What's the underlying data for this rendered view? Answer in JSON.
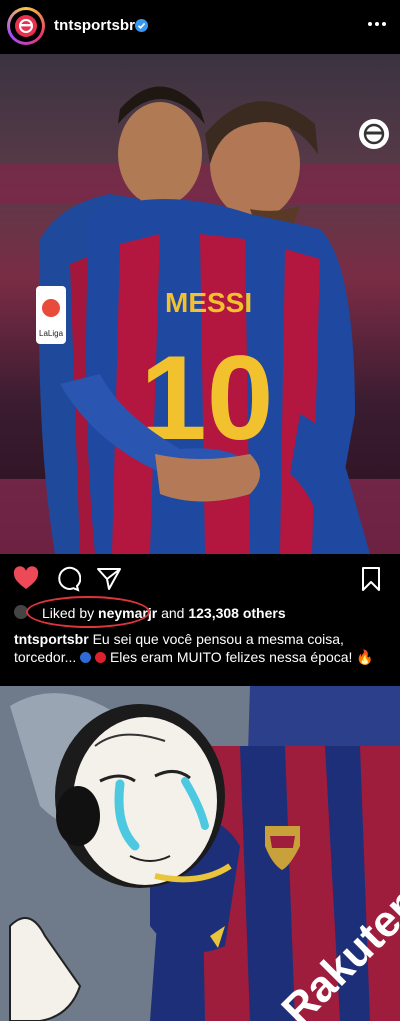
{
  "header": {
    "username": "tntsportsbr",
    "verified_icon": "verified-badge-icon",
    "more_icon": "more-options-icon"
  },
  "post_image_1": {
    "jersey_name": "MESSI",
    "jersey_number": "10",
    "sleeve_badge": "LaLiga"
  },
  "actions": {
    "like_icon": "heart-icon",
    "comment_icon": "comment-icon",
    "share_icon": "share-icon",
    "save_icon": "bookmark-icon",
    "like_color": "#ed4956"
  },
  "likes": {
    "prefix": "Liked by",
    "user": "neymarjr",
    "connector": "and",
    "count": "123,308 others"
  },
  "caption": {
    "username": "tntsportsbr",
    "text_part1": "Eu sei que você pensou a mesma coisa, torcedor...",
    "text_part2": "Eles eram MUITO felizes nessa época!",
    "fire": "🔥"
  },
  "post_image_2": {
    "sponsor": "Rakuten"
  }
}
